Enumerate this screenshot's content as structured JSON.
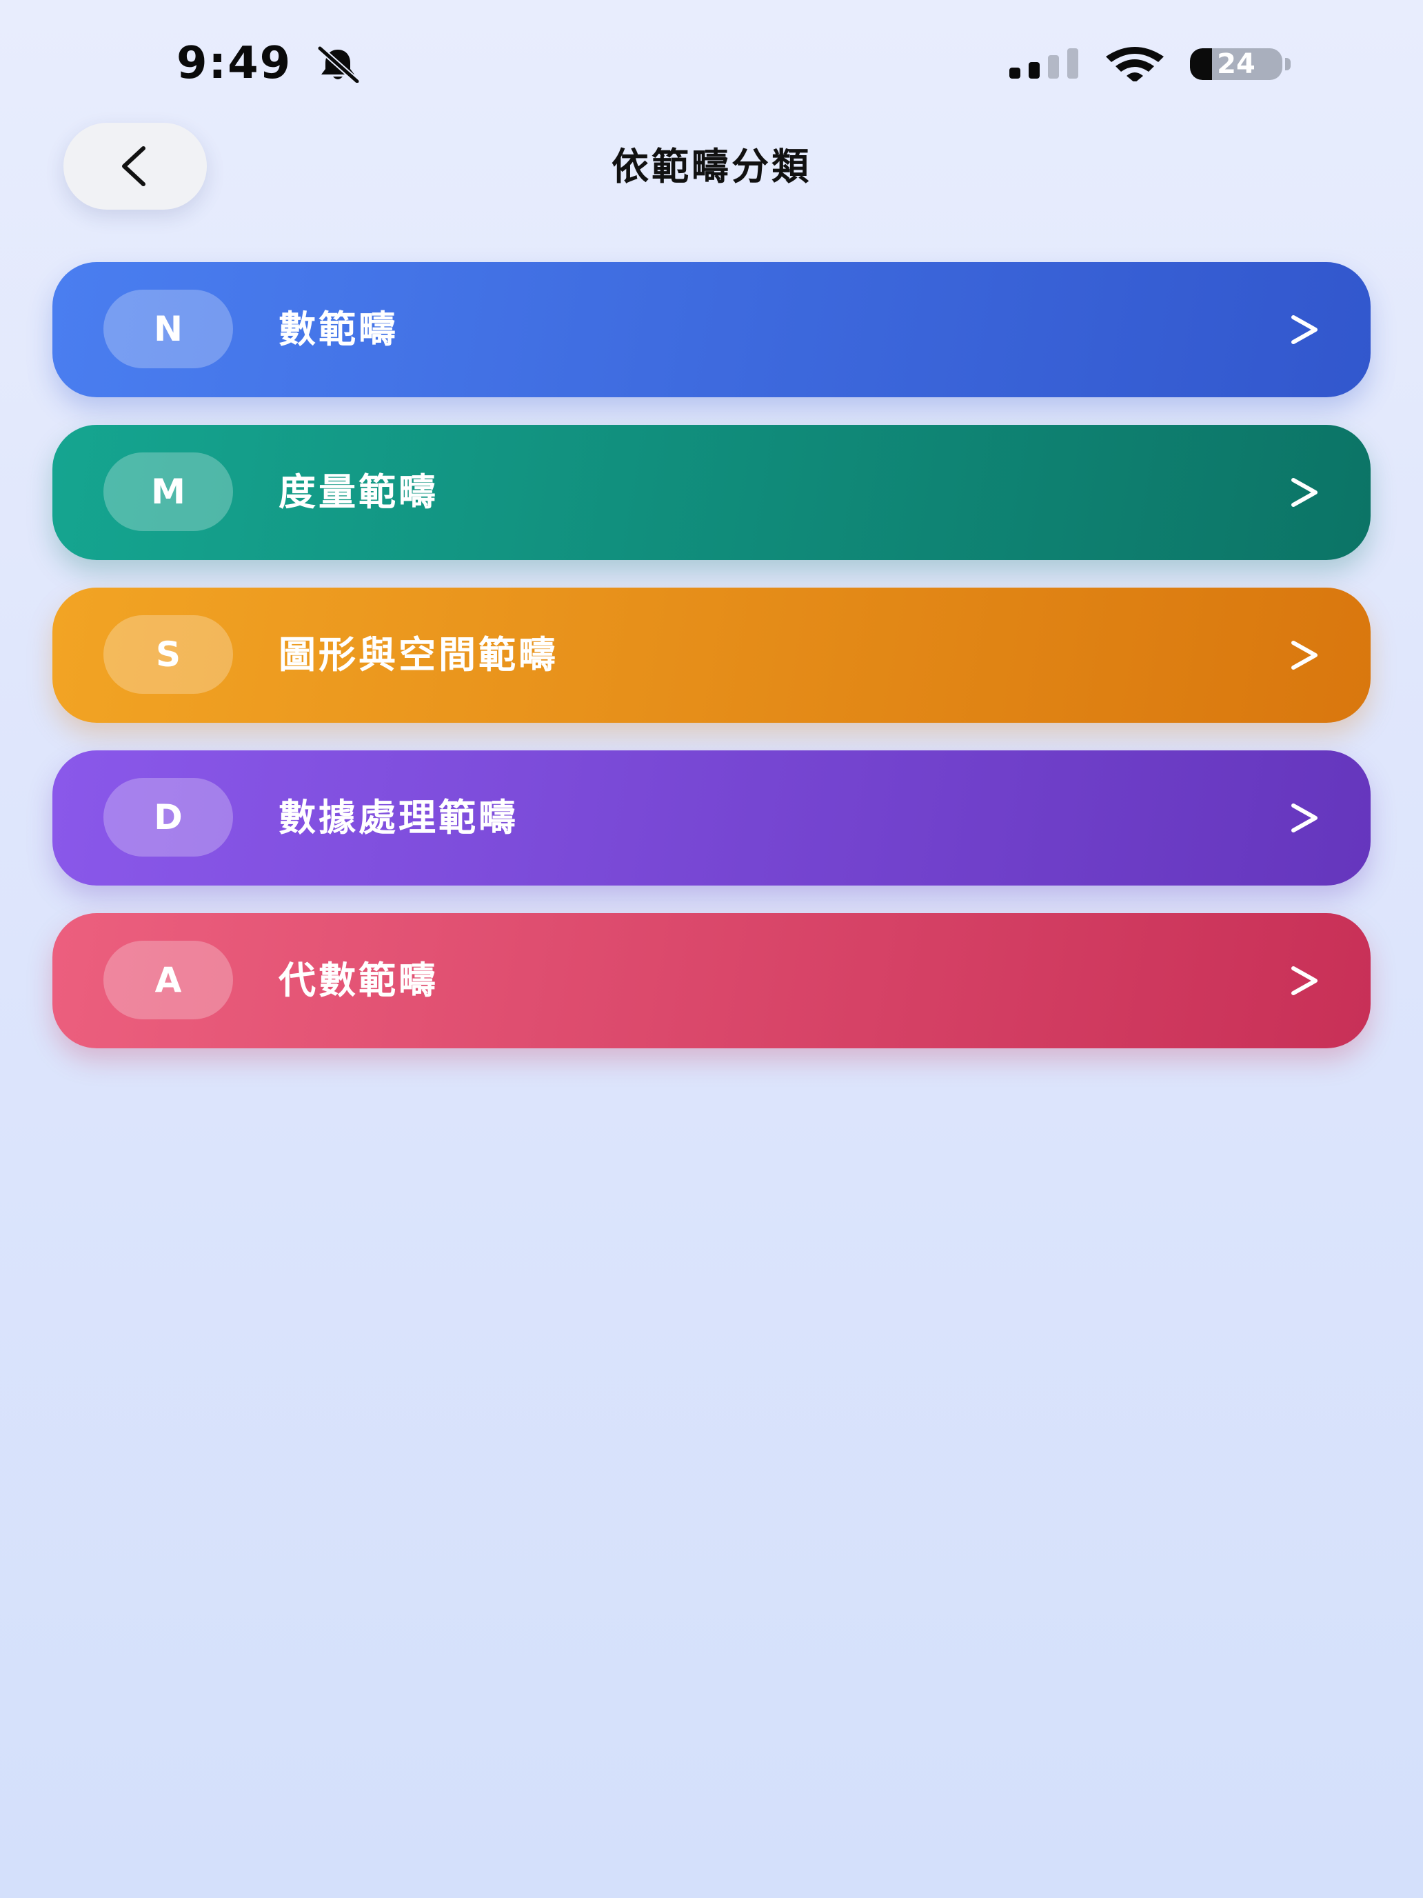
{
  "status_bar": {
    "time": "9:49",
    "silent_icon": "bell-slash-icon",
    "signal_icon": "cellular-signal-icon",
    "signal_bars_active": 2,
    "signal_bars_total": 4,
    "wifi_icon": "wifi-icon",
    "battery_level": "24",
    "battery_fraction": 0.24
  },
  "nav": {
    "back_icon": "chevron-left-icon",
    "title": "依範疇分類"
  },
  "categories": [
    {
      "badge": "N",
      "label": "數範疇",
      "icon": "chevron-right-icon",
      "color_start": "#4a7ef0",
      "color_end": "#3257cd"
    },
    {
      "badge": "M",
      "label": "度量範疇",
      "icon": "chevron-right-icon",
      "color_start": "#15a590",
      "color_end": "#0c7466"
    },
    {
      "badge": "S",
      "label": "圖形與空間範疇",
      "icon": "chevron-right-icon",
      "color_start": "#f2a424",
      "color_end": "#d9770e"
    },
    {
      "badge": "D",
      "label": "數據處理範疇",
      "icon": "chevron-right-icon",
      "color_start": "#8a58ea",
      "color_end": "#6536bd"
    },
    {
      "badge": "A",
      "label": "代數範疇",
      "icon": "chevron-right-icon",
      "color_start": "#ec5f7e",
      "color_end": "#c83057"
    }
  ]
}
